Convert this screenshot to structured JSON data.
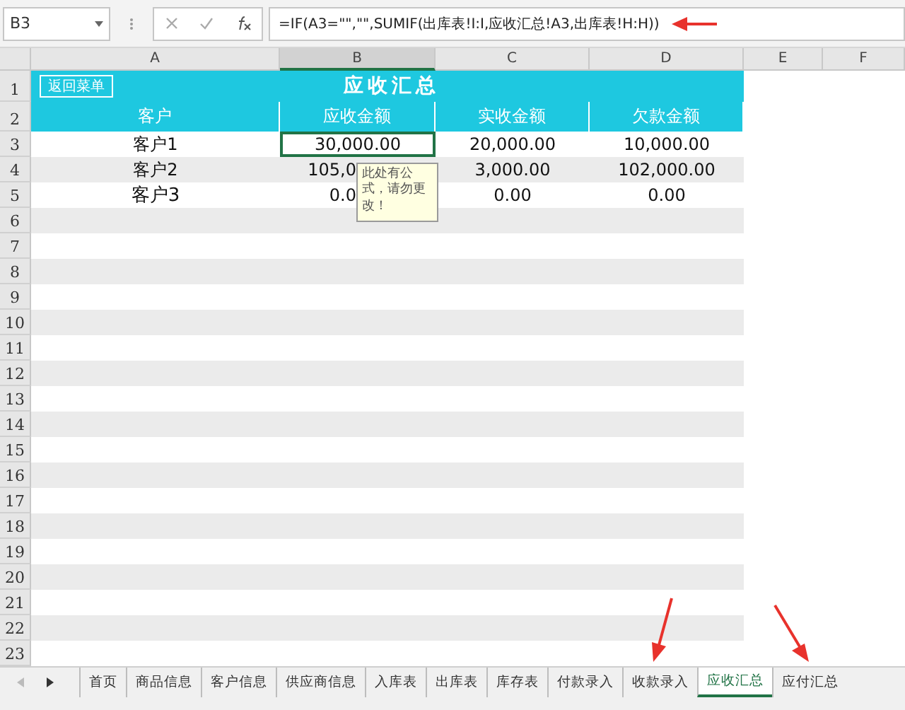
{
  "formula_bar": {
    "name_box": "B3",
    "formula": "=IF(A3=\"\",\"\",SUMIF(出库表!I:I,应收汇总!A3,出库表!H:H))"
  },
  "columns": [
    {
      "label": "A",
      "selected": false
    },
    {
      "label": "B",
      "selected": true
    },
    {
      "label": "C",
      "selected": false
    },
    {
      "label": "D",
      "selected": false
    },
    {
      "label": "E",
      "selected": false
    },
    {
      "label": "F",
      "selected": false
    }
  ],
  "row_numbers": [
    "1",
    "2",
    "3",
    "4",
    "5",
    "6",
    "7",
    "8",
    "9",
    "10",
    "11",
    "12",
    "13",
    "14",
    "15",
    "16",
    "17",
    "18",
    "19",
    "20",
    "21",
    "22",
    "23"
  ],
  "sheet": {
    "back_button": "返回菜单",
    "title": "应收汇总",
    "headers": [
      "客户",
      "应收金额",
      "实收金额",
      "欠款金额"
    ],
    "rows": [
      {
        "cells": [
          "客户1",
          "30,000.00",
          "20,000.00",
          "10,000.00"
        ]
      },
      {
        "cells": [
          "客户2",
          "105,0",
          "3,000.00",
          "102,000.00"
        ]
      },
      {
        "cells": [
          "客户3",
          "0.0",
          "0.00",
          "0.00"
        ]
      }
    ]
  },
  "comment": "此处有公式，请勿更改！",
  "sheet_tabs": [
    {
      "label": "首页",
      "selected": false
    },
    {
      "label": "商品信息",
      "selected": false
    },
    {
      "label": "客户信息",
      "selected": false
    },
    {
      "label": "供应商信息",
      "selected": false
    },
    {
      "label": "入库表",
      "selected": false
    },
    {
      "label": "出库表",
      "selected": false
    },
    {
      "label": "库存表",
      "selected": false
    },
    {
      "label": "付款录入",
      "selected": false
    },
    {
      "label": "收款录入",
      "selected": false
    },
    {
      "label": "应收汇总",
      "selected": true
    },
    {
      "label": "应付汇总",
      "selected": false
    }
  ]
}
